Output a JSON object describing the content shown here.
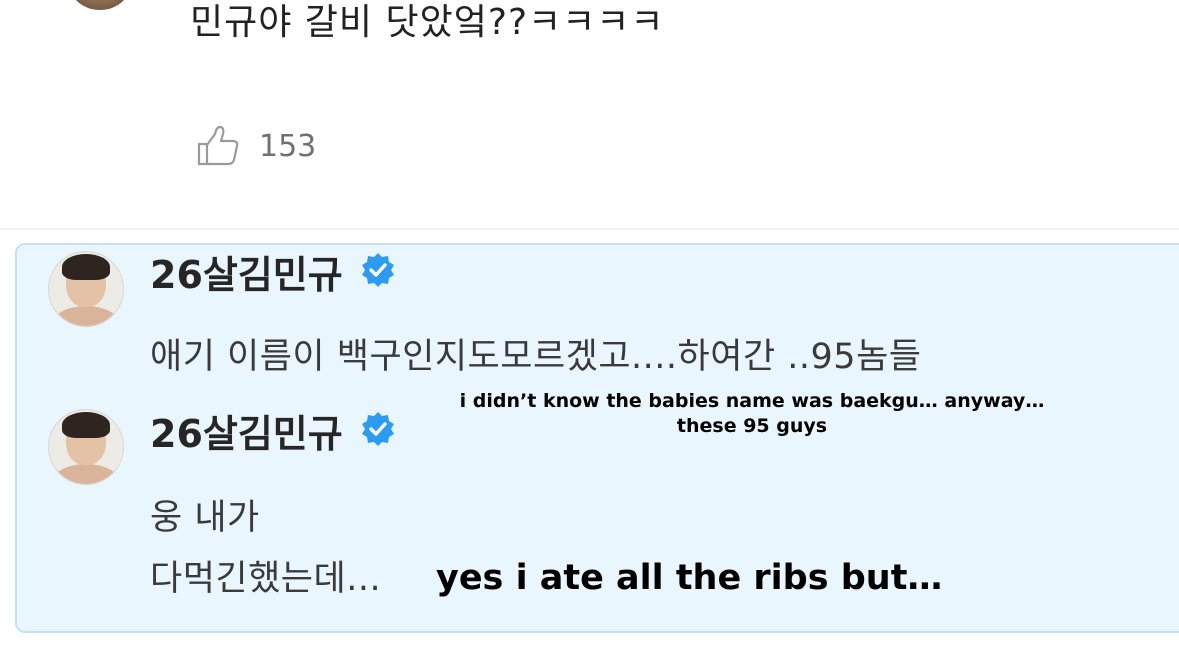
{
  "top_comment": {
    "text": "민규야 갈비 닷았엌??ㅋㅋㅋㅋ",
    "likes": "153"
  },
  "replies": [
    {
      "username": "26살김민규",
      "verified": true,
      "text_lines": [
        "애기 이름이 백구인지도모르겠고....하여간 ..95놈들"
      ]
    },
    {
      "username": "26살김민규",
      "verified": true,
      "text_lines": [
        "웅 내가",
        "다먹긴했는데..."
      ]
    }
  ],
  "captions": {
    "first_line1": "i didn’t know the babies name was baekgu… anyway…",
    "first_line2": "these 95 guys",
    "second": "yes i ate all the ribs but…"
  },
  "colors": {
    "panel_bg": "#eaf6fd",
    "panel_border": "#c9def0",
    "verified_badge": "#2d9cf0",
    "like_count": "#707070"
  },
  "icons": [
    "thumbs-up-icon",
    "verified-badge-icon"
  ]
}
